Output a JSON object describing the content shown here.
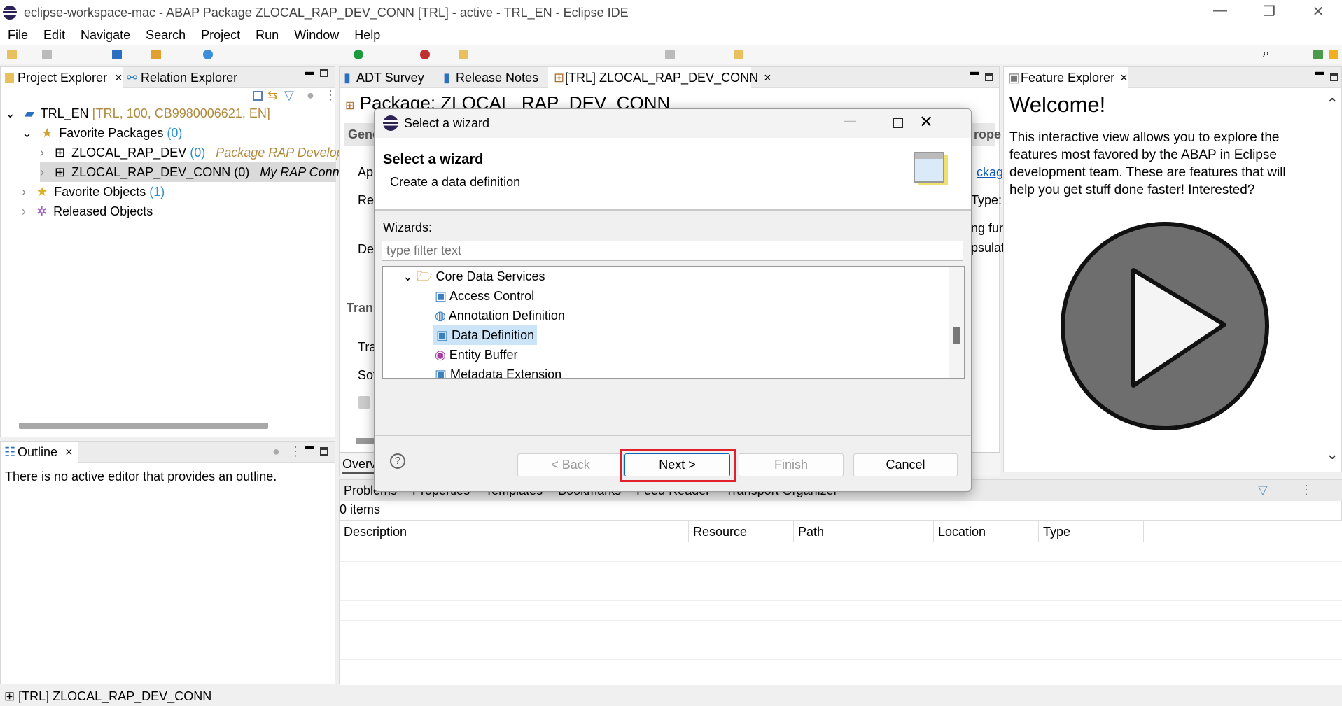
{
  "window": {
    "title": "eclipse-workspace-mac - ABAP Package ZLOCAL_RAP_DEV_CONN [TRL] - active - TRL_EN - Eclipse IDE",
    "minimize": "—",
    "maximize": "❐",
    "close": "✕"
  },
  "menu": [
    "File",
    "Edit",
    "Navigate",
    "Search",
    "Project",
    "Run",
    "Window",
    "Help"
  ],
  "left": {
    "tabs": [
      {
        "label": "Project Explorer",
        "close": "×"
      },
      {
        "label": "Relation Explorer"
      }
    ],
    "tree": [
      {
        "label": "TRL_EN",
        "extra": "[TRL, 100, CB9980006621, EN]"
      },
      {
        "label": "Favorite Packages",
        "count": "(0)"
      },
      {
        "label": "ZLOCAL_RAP_DEV",
        "count": "(0)",
        "desc": "Package RAP Developme"
      },
      {
        "label": "ZLOCAL_RAP_DEV_CONN",
        "count": "(0)",
        "desc": "My RAP Connectio"
      },
      {
        "label": "Favorite Objects",
        "count": "(1)"
      },
      {
        "label": "Released Objects"
      }
    ],
    "outline": {
      "tab": "Outline",
      "close": "×",
      "message": "There is no active editor that provides an outline."
    }
  },
  "editor": {
    "tabs": [
      {
        "label": "ADT Survey"
      },
      {
        "label": "Release Notes"
      },
      {
        "label": "[TRL] ZLOCAL_RAP_DEV_CONN",
        "close": "×"
      }
    ],
    "title": "Package: ZLOCAL_RAP_DEV_CONN",
    "fragments": {
      "general": "Gene",
      "ap": "Ap",
      "res": "Res",
      "de": "De",
      "tran": "Tran",
      "tra": "Tra",
      "sof": "Sof",
      "overview": "Overv",
      "prope": "rope",
      "package_link": "ckage",
      "type": "Type:",
      "fun": "ng fur",
      "encap": "psulat"
    }
  },
  "feature": {
    "tab": "Feature Explorer",
    "close": "×",
    "welcome": "Welcome!",
    "text": "This interactive view allows you to explore the features most favored by the ABAP in Eclipse development team. These are features that will help you get stuff done faster! Interested?"
  },
  "bottom": {
    "tabs": [
      "Problems",
      "Properties",
      "Templates",
      "Bookmarks",
      "Feed Reader",
      "Transport Organizer"
    ],
    "count": "0 items",
    "columns": [
      "Description",
      "Resource",
      "Path",
      "Location",
      "Type"
    ]
  },
  "status": {
    "text": "[TRL] ZLOCAL_RAP_DEV_CONN"
  },
  "dialog": {
    "title": "Select a wizard",
    "heading": "Select a wizard",
    "subtitle": "Create a data definition",
    "wizards_label": "Wizards:",
    "filter_placeholder": "type filter text",
    "tree": {
      "folder": "Core Data Services",
      "items": [
        "Access Control",
        "Annotation Definition",
        "Data Definition",
        "Entity Buffer",
        "Metadata Extension"
      ],
      "selected": "Data Definition"
    },
    "help": "?",
    "back": "< Back",
    "next": "Next >",
    "finish": "Finish",
    "cancel": "Cancel",
    "highlight_color": "#e0202a"
  }
}
